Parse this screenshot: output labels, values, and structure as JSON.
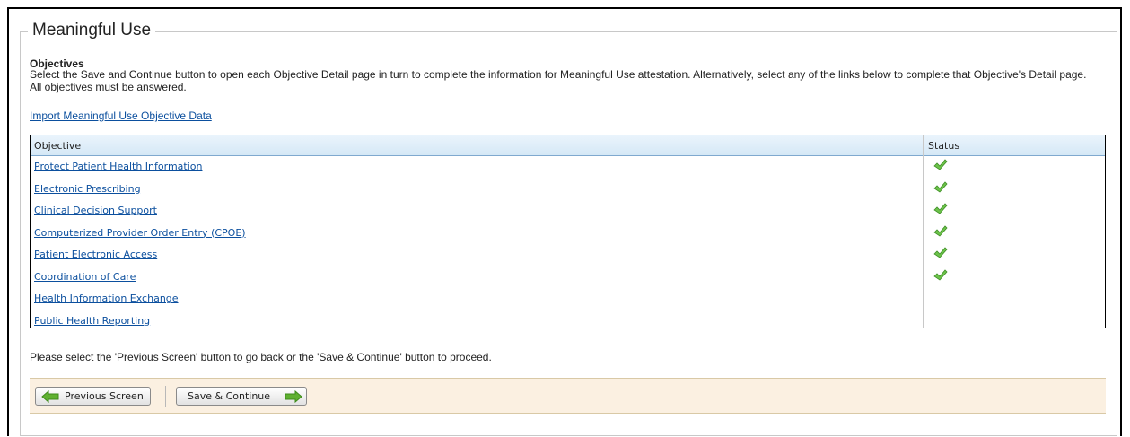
{
  "section": {
    "title": "Meaningful Use",
    "subheading": "Objectives",
    "intro": "Select the Save and Continue button to open each Objective Detail page in turn to complete the information for Meaningful Use attestation. Alternatively, select any of the links below to complete that Objective's Detail page. All objectives must be answered.",
    "import_link": "Import Meaningful Use Objective Data"
  },
  "table": {
    "columns": [
      "Objective",
      "Status"
    ],
    "rows": [
      {
        "objective": "Protect Patient Health Information",
        "status": "complete",
        "status_icon": "green-check-icon"
      },
      {
        "objective": "Electronic Prescribing",
        "status": "complete",
        "status_icon": "green-check-icon"
      },
      {
        "objective": "Clinical Decision Support",
        "status": "complete",
        "status_icon": "green-check-icon"
      },
      {
        "objective": "Computerized Provider Order Entry (CPOE)",
        "status": "complete",
        "status_icon": "green-check-icon"
      },
      {
        "objective": "Patient Electronic Access",
        "status": "complete",
        "status_icon": "green-check-icon"
      },
      {
        "objective": "Coordination of Care",
        "status": "complete",
        "status_icon": "green-check-icon"
      },
      {
        "objective": "Health Information Exchange",
        "status": "",
        "status_icon": ""
      },
      {
        "objective": "Public Health Reporting",
        "status": "",
        "status_icon": ""
      }
    ]
  },
  "footer": {
    "note": "Please select the 'Previous Screen' button to go back or the 'Save & Continue' button to proceed.",
    "previous_label": "Previous Screen",
    "save_label": "Save & Continue"
  },
  "colors": {
    "link": "#0b4f9e",
    "check": "#6cc24a",
    "arrow": "#5fb030",
    "header_bg": "#d5e8f6",
    "button_bar_bg": "#fbf0e1"
  }
}
